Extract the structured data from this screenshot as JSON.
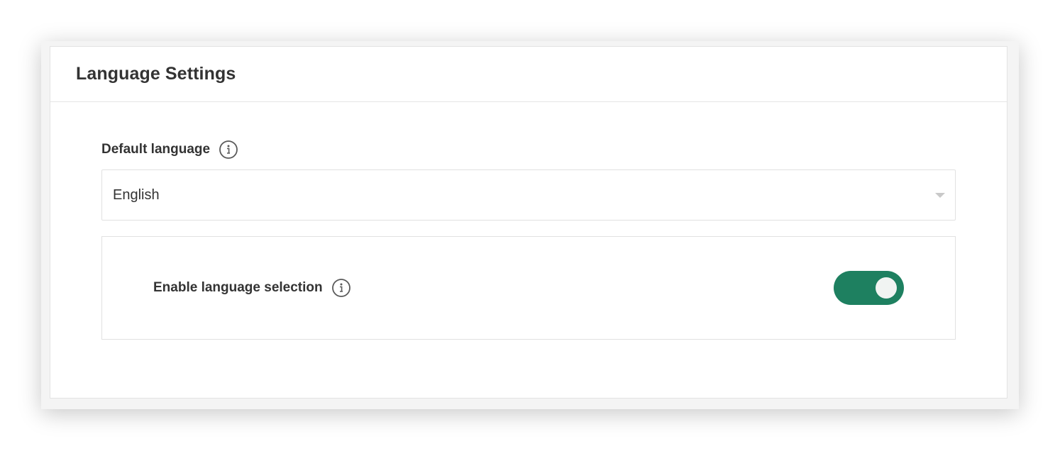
{
  "panel": {
    "title": "Language Settings"
  },
  "default_language": {
    "label": "Default language",
    "info_icon": "info-circle-icon",
    "selected_value": "English",
    "caret_icon": "chevron-down-icon"
  },
  "language_selection": {
    "label": "Enable language selection",
    "info_icon": "info-circle-icon",
    "enabled": true
  },
  "colors": {
    "toggle_on": "#1e8060",
    "text": "#333333",
    "border": "#e1e1e1"
  }
}
